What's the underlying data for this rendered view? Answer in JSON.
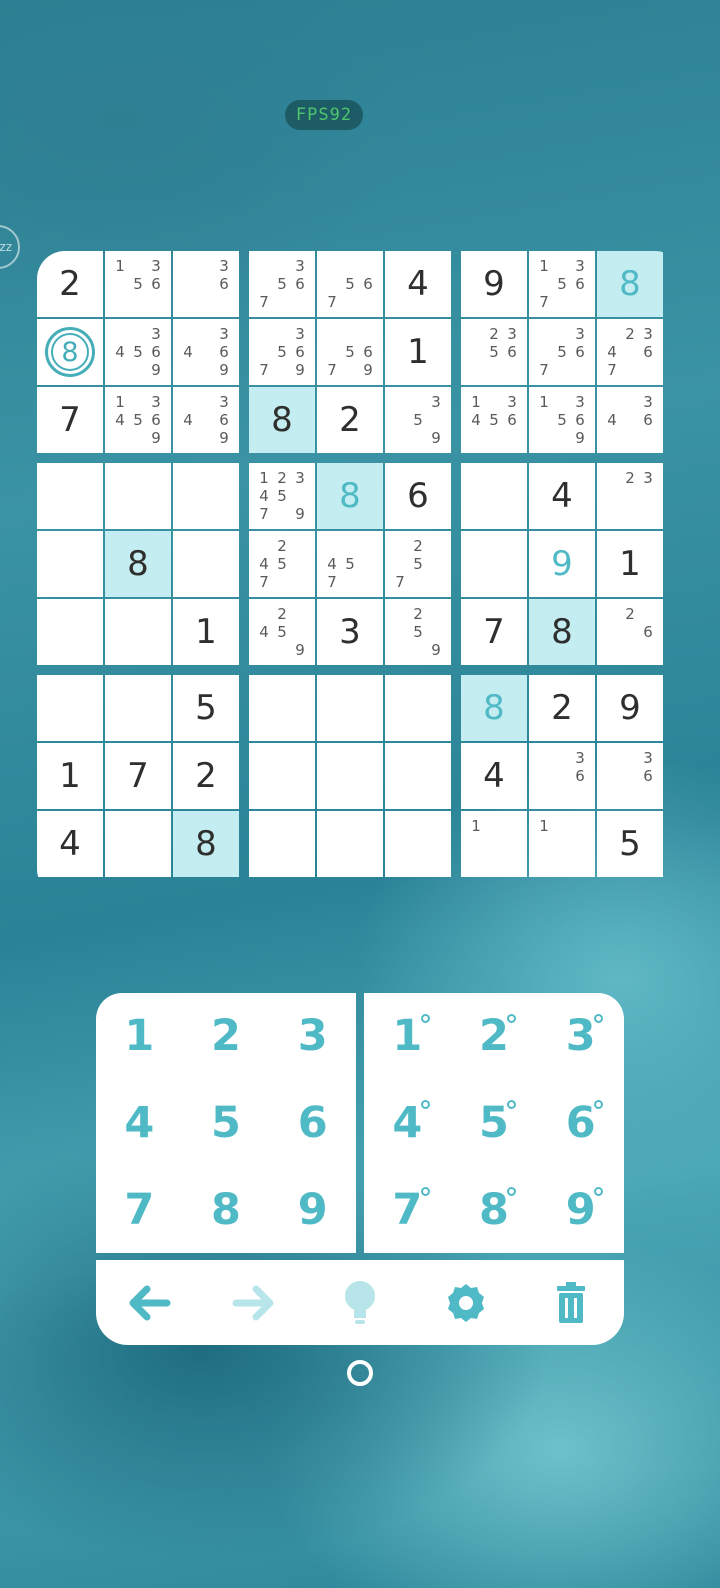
{
  "fps_label": "FPS92",
  "side_control_label": "zz",
  "board": {
    "cells": [
      {
        "v": "2"
      },
      {
        "n": "1 3 56"
      },
      {
        "n": "  3  6"
      },
      {
        "n": "  356 7 "
      },
      {
        "n": "    567  "
      },
      {
        "v": "4"
      },
      {
        "v": "9"
      },
      {
        "n": "1 3567  "
      },
      {
        "v": "8",
        "blue": true,
        "hl": true
      },
      {
        "v": "8",
        "sel": true
      },
      {
        "n": "  3456  9"
      },
      {
        "n": "  34 6  9"
      },
      {
        "n": "  3567 9"
      },
      {
        "n": "    567 9"
      },
      {
        "v": "1"
      },
      {
        "n": " 23 56   "
      },
      {
        "n": "  3 567  "
      },
      {
        "n": " 234 67  "
      },
      {
        "v": "7"
      },
      {
        "n": "1 3456  9"
      },
      {
        "n": "  34 6  9"
      },
      {
        "v": "8",
        "hl": true
      },
      {
        "v": "2"
      },
      {
        "n": "  3 5   9"
      },
      {
        "n": "1 3456   "
      },
      {
        "n": "1 3 56  9"
      },
      {
        "n": "  34 6   "
      },
      {},
      {},
      {},
      {
        "n": "123457 9"
      },
      {
        "v": "8",
        "blue": true,
        "hl": true
      },
      {
        "v": "6"
      },
      {},
      {
        "v": "4"
      },
      {
        "n": " 23      "
      },
      {},
      {
        "v": "8",
        "hl": true
      },
      {},
      {
        "n": " 2 45 7  "
      },
      {
        "n": "   45 7  "
      },
      {
        "n": " 2  5 7  "
      },
      {},
      {
        "v": "9",
        "blue": true
      },
      {
        "v": "1"
      },
      {},
      {},
      {
        "v": "1"
      },
      {
        "n": " 2 45   9"
      },
      {
        "v": "3"
      },
      {
        "n": " 2  5   9"
      },
      {
        "v": "7"
      },
      {
        "v": "8",
        "hl": true
      },
      {
        "n": " 2   6   "
      },
      {},
      {},
      {
        "v": "5"
      },
      {},
      {},
      {},
      {
        "v": "8",
        "blue": true,
        "hl": true
      },
      {
        "v": "2"
      },
      {
        "v": "9"
      },
      {
        "v": "1"
      },
      {
        "v": "7"
      },
      {
        "v": "2"
      },
      {},
      {},
      {},
      {
        "v": "4"
      },
      {
        "n": "  3  6   "
      },
      {
        "n": "  3  6   "
      },
      {
        "v": "4"
      },
      {},
      {
        "v": "8",
        "hl": true
      },
      {},
      {},
      {},
      {
        "n": "1        "
      },
      {
        "n": "1        "
      },
      {
        "v": "5"
      }
    ]
  },
  "keypad": {
    "numbers": [
      "1",
      "2",
      "3",
      "4",
      "5",
      "6",
      "7",
      "8",
      "9"
    ],
    "notes": [
      "1",
      "2",
      "3",
      "4",
      "5",
      "6",
      "7",
      "8",
      "9"
    ]
  },
  "toolbar": {
    "undo_icon": "arrow-left-icon",
    "redo_icon": "arrow-right-icon",
    "hint_icon": "lightbulb-icon",
    "settings_icon": "gear-icon",
    "delete_icon": "trash-icon"
  },
  "colors": {
    "accent": "#4fbac6",
    "highlight": "#c4edf1",
    "digit": "#2f2f2f",
    "fps": "#4fc46f"
  }
}
